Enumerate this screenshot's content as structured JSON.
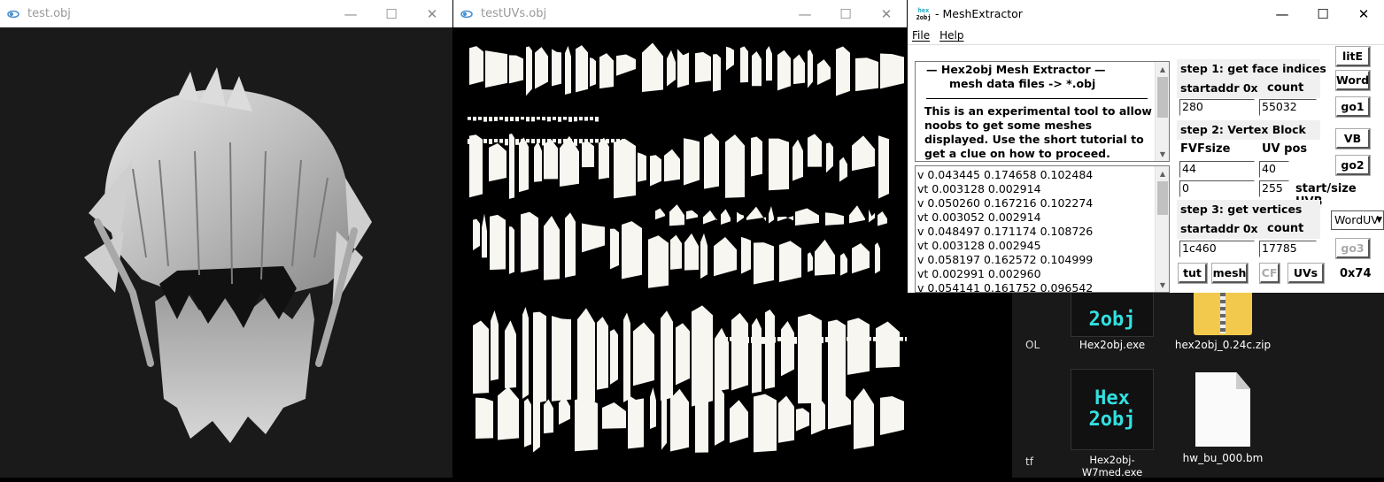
{
  "windows": {
    "model": {
      "title": "test.obj"
    },
    "uvs": {
      "title": "testUVs.obj"
    },
    "mesh": {
      "title": "- MeshExtractor",
      "app_icon_text": [
        "hex",
        "2obj"
      ],
      "menu": [
        "File",
        "Help"
      ],
      "info_title_lines": [
        "—   Hex2obj Mesh Extractor   —",
        "mesh data files -> *.obj"
      ],
      "info_body": "This is an experimental tool to allow noobs to get some meshes displayed. Use the short tutorial to get a clue on how to proceed.",
      "output_lines": [
        "v 0.043445 0.174658 0.102484",
        "vt 0.003128 0.002914",
        "v 0.050260 0.167216 0.102274",
        "vt 0.003052 0.002914",
        "v 0.048497 0.171174 0.108726",
        "vt 0.003128 0.002945",
        "v 0.058197 0.162572 0.104999",
        "vt 0.002991 0.002960",
        "v 0.054141 0.161752 0.096542"
      ],
      "step1": {
        "title": "step 1: get face indices",
        "startaddr_label": "startaddr 0x",
        "count_label": "count",
        "startaddr": "280",
        "count": "55032"
      },
      "step2": {
        "title": "step 2: Vertex Block",
        "fvf_label": "FVFsize",
        "uvpos_label": "UV pos",
        "fvf": "44",
        "uvpos": "40",
        "start": "0",
        "size": "255",
        "startsize_label": "start/size UVB"
      },
      "step3": {
        "title": "step 3: get vertices",
        "startaddr_label": "startaddr 0x",
        "count_label": "count",
        "startaddr": "1c460",
        "count": "17785"
      },
      "buttons": {
        "lite": "litE",
        "word": "Word",
        "go1": "go1",
        "vb": "VB",
        "go2": "go2",
        "go3": "go3",
        "tut": "tut",
        "mesh": "mesh",
        "cf": "CF",
        "uvs": "UVs"
      },
      "worduv_select": "WordUV",
      "hex_readout": "0x74"
    }
  },
  "desktop": {
    "items": [
      {
        "label": "Hex2obj.exe",
        "icon_text": "2obj"
      },
      {
        "label": "hex2obj_0.24c.zip"
      },
      {
        "label": "Hex2obj-W7med.exe",
        "icon_text": [
          "Hex",
          "2obj"
        ]
      },
      {
        "label": "hw_bu_000.bm"
      }
    ],
    "clipped_left": [
      "OL",
      "tf"
    ]
  },
  "colors": {
    "viewport_bg": "#1a1a1a",
    "uv_fill": "#f7f6f0",
    "desktop_bg": "#000000",
    "hex_icon_cyan": "#33e0e0",
    "zip_yellow": "#f2c94c"
  }
}
